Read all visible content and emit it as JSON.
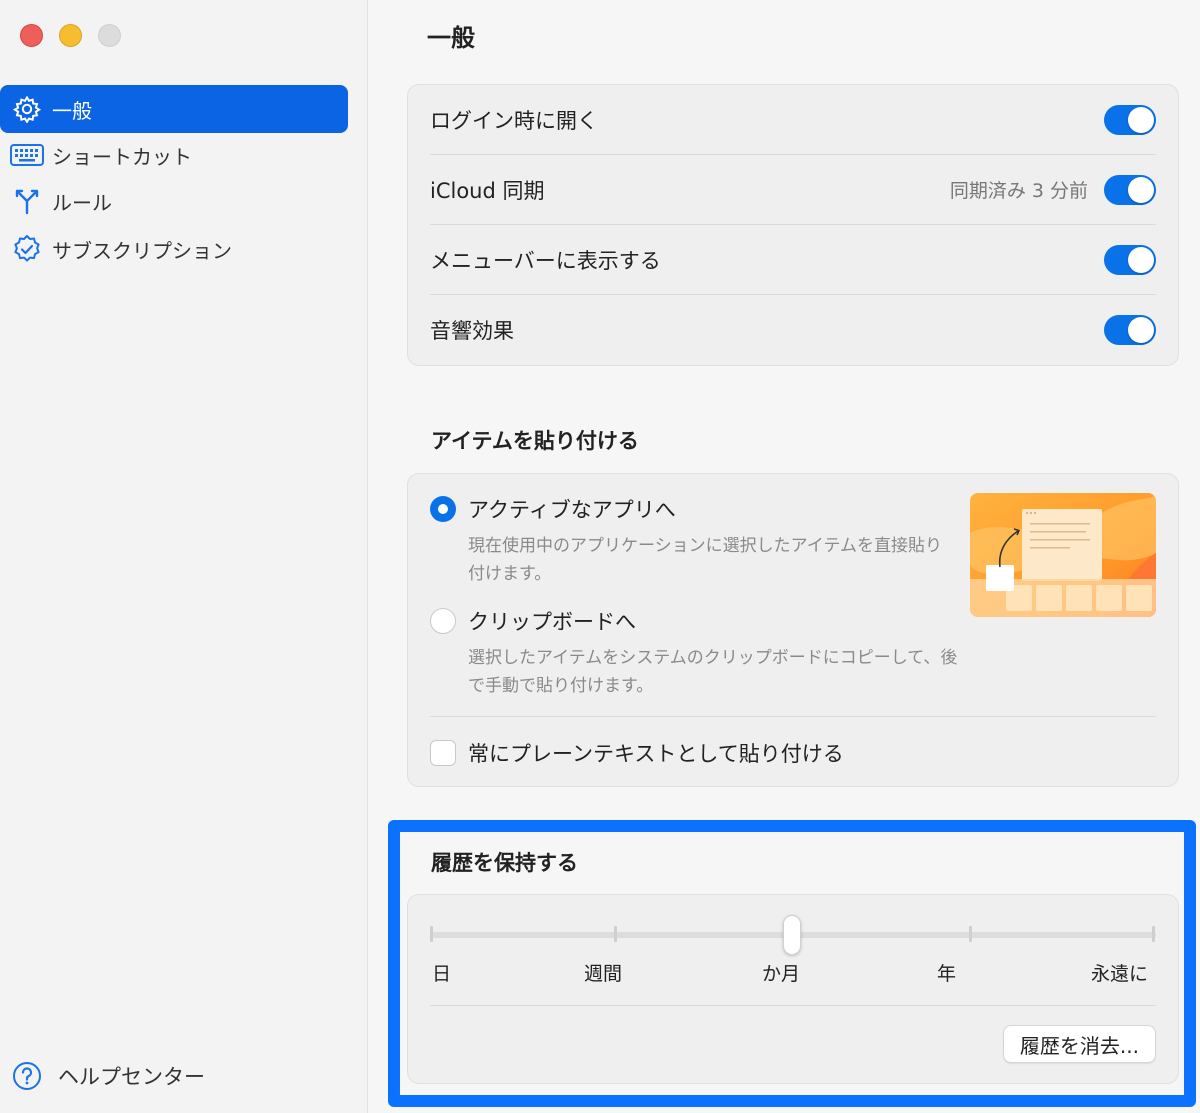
{
  "sidebar": {
    "items": [
      {
        "label": "一般",
        "icon": "gear-icon"
      },
      {
        "label": "ショートカット",
        "icon": "keyboard-icon"
      },
      {
        "label": "ルール",
        "icon": "fork-icon"
      },
      {
        "label": "サブスクリプション",
        "icon": "verified-badge-icon"
      }
    ],
    "help_label": "ヘルプセンター"
  },
  "main": {
    "title": "一般",
    "general": {
      "rows": [
        {
          "label": "ログイン時に開く",
          "on": true
        },
        {
          "label": "iCloud 同期",
          "status": "同期済み 3 分前",
          "on": true
        },
        {
          "label": "メニューバーに表示する",
          "on": true
        },
        {
          "label": "音響効果",
          "on": true
        }
      ]
    },
    "paste": {
      "title": "アイテムを貼り付ける",
      "option_active": {
        "label": "アクティブなアプリへ",
        "desc": "現在使用中のアプリケーションに選択したアイテムを直接貼り付けます。",
        "selected": true
      },
      "option_clipboard": {
        "label": "クリップボードへ",
        "desc": "選択したアイテムをシステムのクリップボードにコピーして、後で手動で貼り付けます。",
        "selected": false
      },
      "plain_text_label": "常にプレーンテキストとして貼り付ける"
    },
    "history": {
      "title": "履歴を保持する",
      "slider_labels": [
        "日",
        "週間",
        "か月",
        "年",
        "永遠に"
      ],
      "selected_index": 2,
      "clear_button": "履歴を消去..."
    }
  },
  "colors": {
    "accent": "#0a72e8",
    "highlight": "#0a72ff",
    "sidebar_active": "#0a64e3"
  }
}
